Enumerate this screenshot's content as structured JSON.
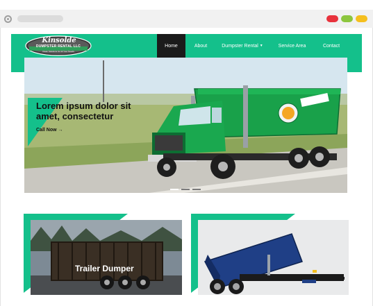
{
  "browser": {
    "window_buttons": [
      "close",
      "minimize",
      "maximize"
    ],
    "colors": {
      "close": "#e8323c",
      "minimize": "#8cc63e",
      "maximize": "#f5bf1e"
    }
  },
  "header": {
    "logo": {
      "name": "Kinsolde",
      "tagline": "DUMPSTER RENTAL LLC",
      "sub": "Clean Solutions for All Your Needs"
    },
    "nav": [
      {
        "label": "Home",
        "active": true
      },
      {
        "label": "About",
        "active": false
      },
      {
        "label": "Dumpster Rental",
        "active": false,
        "has_dropdown": true
      },
      {
        "label": "Service Area",
        "active": false
      },
      {
        "label": "Contact",
        "active": false
      }
    ],
    "accent_color": "#14c08b"
  },
  "hero": {
    "title": "Lorem ipsum dolor sit amet, consectetur",
    "cta_label": "Call Now",
    "cta_icon": "arrow-right-icon",
    "slides": 3,
    "active_slide": 1
  },
  "cards": [
    {
      "label": "Trailer Dumper"
    },
    {
      "label": ""
    }
  ]
}
